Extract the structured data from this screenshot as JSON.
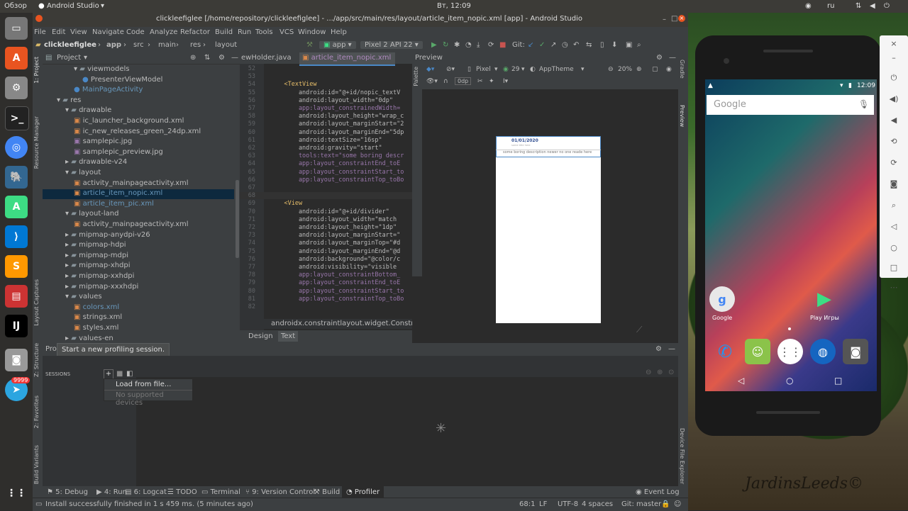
{
  "top_panel": {
    "activities": "Обзор",
    "app_name": "Android Studio",
    "clock": "Вт, 12:09",
    "lang": "ru"
  },
  "launcher_badge": "9999",
  "ide": {
    "title": "clickleefiglee [/home/repository/clickleefiglee] - .../app/src/main/res/layout/article_item_nopic.xml [app] - Android Studio",
    "menu": [
      "File",
      "Edit",
      "View",
      "Navigate",
      "Code",
      "Analyze",
      "Refactor",
      "Build",
      "Run",
      "Tools",
      "VCS",
      "Window",
      "Help"
    ],
    "breadcrumbs": [
      "clickleefiglee",
      "app",
      "src",
      "main",
      "res",
      "layout"
    ],
    "run_config": "app",
    "device": "Pixel 2 API 22",
    "git_label": "Git:",
    "project_label": "Project",
    "tree": [
      {
        "label": "viewmodels",
        "indent": 4,
        "type": "folder"
      },
      {
        "label": "PresenterViewModel",
        "indent": 5,
        "type": "class"
      },
      {
        "label": "MainPageActivity",
        "indent": 4,
        "type": "class"
      },
      {
        "label": "res",
        "indent": 2,
        "type": "folder"
      },
      {
        "label": "drawable",
        "indent": 3,
        "type": "folder"
      },
      {
        "label": "ic_launcher_background.xml",
        "indent": 4,
        "type": "xml"
      },
      {
        "label": "ic_new_releases_green_24dp.xml",
        "indent": 4,
        "type": "xml"
      },
      {
        "label": "samplepic.jpg",
        "indent": 4,
        "type": "img"
      },
      {
        "label": "samplepic_preview.jpg",
        "indent": 4,
        "type": "img"
      },
      {
        "label": "drawable-v24",
        "indent": 3,
        "type": "folder"
      },
      {
        "label": "layout",
        "indent": 3,
        "type": "folder"
      },
      {
        "label": "activity_mainpageactivity.xml",
        "indent": 4,
        "type": "xml"
      },
      {
        "label": "article_item_nopic.xml",
        "indent": 4,
        "type": "xml",
        "selected": true
      },
      {
        "label": "article_item_pic.xml",
        "indent": 4,
        "type": "xml"
      },
      {
        "label": "layout-land",
        "indent": 3,
        "type": "folder"
      },
      {
        "label": "activity_mainpageactivity.xml",
        "indent": 4,
        "type": "xml"
      },
      {
        "label": "mipmap-anydpi-v26",
        "indent": 3,
        "type": "folder"
      },
      {
        "label": "mipmap-hdpi",
        "indent": 3,
        "type": "folder"
      },
      {
        "label": "mipmap-mdpi",
        "indent": 3,
        "type": "folder"
      },
      {
        "label": "mipmap-xhdpi",
        "indent": 3,
        "type": "folder"
      },
      {
        "label": "mipmap-xxhdpi",
        "indent": 3,
        "type": "folder"
      },
      {
        "label": "mipmap-xxxhdpi",
        "indent": 3,
        "type": "folder"
      },
      {
        "label": "values",
        "indent": 3,
        "type": "folder"
      },
      {
        "label": "colors.xml",
        "indent": 4,
        "type": "xml"
      },
      {
        "label": "strings.xml",
        "indent": 4,
        "type": "xml"
      },
      {
        "label": "styles.xml",
        "indent": 4,
        "type": "xml"
      },
      {
        "label": "values-en",
        "indent": 3,
        "type": "folder"
      }
    ],
    "tabs": [
      "ewHolder.java",
      "article_item_nopic.xml"
    ],
    "code_lines": [
      {
        "n": "52",
        "t": ""
      },
      {
        "n": "53",
        "t": ""
      },
      {
        "n": "54",
        "t": "    <TextView"
      },
      {
        "n": "55",
        "t": "        android:id=\"@+id/nopic_textV"
      },
      {
        "n": "56",
        "t": "        android:layout_width=\"0dp\""
      },
      {
        "n": "57",
        "t": "        app:layout_constrainedWidth="
      },
      {
        "n": "58",
        "t": "        android:layout_height=\"wrap_c"
      },
      {
        "n": "59",
        "t": "        android:layout_marginStart=\"2"
      },
      {
        "n": "60",
        "t": "        android:layout_marginEnd=\"5dp"
      },
      {
        "n": "61",
        "t": "        android:textSize=\"16sp\""
      },
      {
        "n": "62",
        "t": "        android:gravity=\"start\""
      },
      {
        "n": "63",
        "t": "        tools:text=\"some boring descr"
      },
      {
        "n": "64",
        "t": "        app:layout_constraintEnd_toE"
      },
      {
        "n": "65",
        "t": "        app:layout_constraintStart_to"
      },
      {
        "n": "66",
        "t": "        app:layout_constraintTop_toBo"
      },
      {
        "n": "67",
        "t": ""
      },
      {
        "n": "68",
        "t": ""
      },
      {
        "n": "69",
        "t": "    <View"
      },
      {
        "n": "70",
        "t": "        android:id=\"@+id/divider\""
      },
      {
        "n": "71",
        "t": "        android:layout_width=\"match"
      },
      {
        "n": "72",
        "t": "        android:layout_height=\"1dp\""
      },
      {
        "n": "73",
        "t": "        android:layout_marginStart=\""
      },
      {
        "n": "74",
        "t": "        android:layout_marginTop=\"#d"
      },
      {
        "n": "75",
        "t": "        android:layout_marginEnd=\"@d"
      },
      {
        "n": "76",
        "t": "        android:background=\"@color/c"
      },
      {
        "n": "77",
        "t": "        android:visibility=\"visible"
      },
      {
        "n": "78",
        "t": "        app:layout_constraintBottom_"
      },
      {
        "n": "79",
        "t": "        app:layout_constraintEnd_toE"
      },
      {
        "n": "80",
        "t": "        app:layout_constraintStart_to"
      },
      {
        "n": "81",
        "t": "        app:layout_constraintTop_toBo"
      },
      {
        "n": "82",
        "t": ""
      }
    ],
    "code_footer": "androidx.constraintlayout.widget.Constra",
    "editor_tabs": [
      "Design",
      "Text"
    ],
    "preview": {
      "label": "Preview",
      "device": "Pixel",
      "api": "29",
      "theme": "AppTheme",
      "zoom": "20%",
      "margin": "0dp",
      "date": "01/01/2020",
      "title_hint": "some title here",
      "desc": "some boring description newer no one reade here"
    },
    "profiler": {
      "label": "Pro",
      "tooltip": "Start a new profiling session.",
      "sessions": "SESSIONS",
      "menu": [
        "Load from file...",
        "No supported devices"
      ]
    },
    "left_tools": [
      "1: Project",
      "Resource Manager",
      "Layout Captures",
      "Z: Structure",
      "2: Favorites",
      "Build Variants"
    ],
    "right_tools": [
      "Gradle",
      "Preview",
      "Palette",
      "Device File Explorer"
    ],
    "bottom_tools": [
      "5: Debug",
      "4: Run",
      "6: Logcat",
      "TODO",
      "Terminal",
      "9: Version Control",
      "Build",
      "Profiler",
      "Event Log"
    ],
    "status": {
      "message": "Install successfully finished in 1 s 459 ms. (5 minutes ago)",
      "pos": "68:1",
      "lf": "LF",
      "enc": "UTF-8",
      "indent": "4 spaces",
      "git": "Git: master"
    }
  },
  "phone": {
    "time": "12:09",
    "search": "Google",
    "apps": [
      {
        "label": "Google"
      },
      {
        "label": "Play Игры"
      }
    ]
  },
  "watermark": "JardinsLeeds©",
  "colors": {
    "accent": "#4a88c7",
    "selection": "#0d293e",
    "ide_bg": "#2b2b2b",
    "panel": "#3c3f41"
  }
}
